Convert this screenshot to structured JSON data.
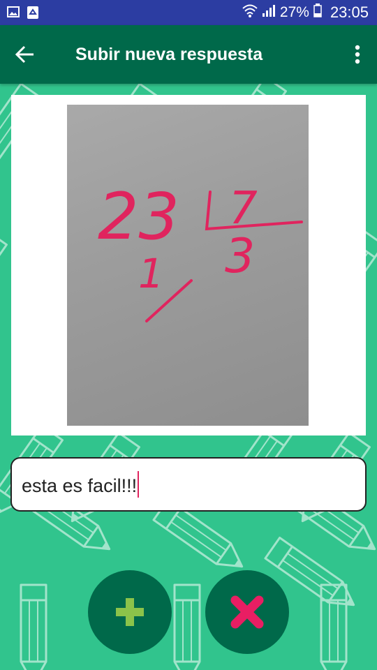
{
  "status_bar": {
    "icons_left": [
      "gallery-icon",
      "recycle-icon"
    ],
    "icons_right": [
      "wifi-icon",
      "signal-icon",
      "battery-icon"
    ],
    "battery": "27%",
    "time": "23:05"
  },
  "app_bar": {
    "title": "Subir nueva respuesta",
    "back_icon": "arrow-back-icon",
    "menu_icon": "more-vert-icon"
  },
  "photo": {
    "handwriting": {
      "dividend": "23",
      "divisor": "7",
      "quotient": "3",
      "remainder": "1"
    }
  },
  "answer": {
    "value": "esta es facil!!!"
  },
  "actions": {
    "add_icon": "plus-icon",
    "cancel_icon": "close-icon"
  },
  "colors": {
    "status_bar": "#2c3da2",
    "app_bar": "#00694a",
    "background": "#31c48d",
    "fab": "#00694a",
    "add_icon": "#8bc34a",
    "cancel_icon": "#e91e63",
    "caret": "#e0245e"
  }
}
